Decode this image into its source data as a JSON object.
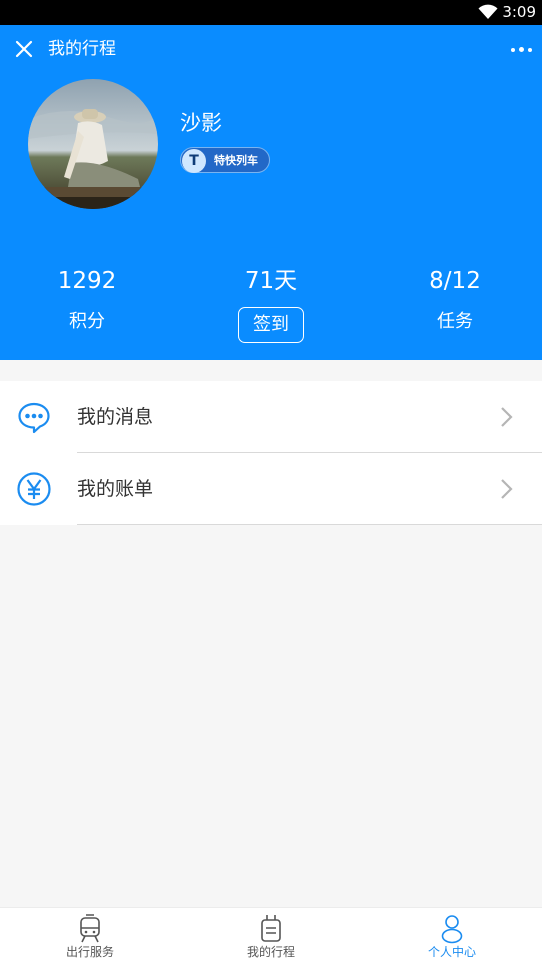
{
  "status_bar": {
    "time": "3:09"
  },
  "header": {
    "title": "我的行程"
  },
  "profile": {
    "username": "沙影",
    "badge": {
      "letter": "T",
      "text": "特快列车"
    }
  },
  "stats": [
    {
      "value": "1292",
      "label": "积分"
    },
    {
      "value": "71天",
      "button_label": "签到"
    },
    {
      "value": "8/12",
      "label": "任务"
    }
  ],
  "menu": [
    {
      "label": "我的消息",
      "icon": "message-icon"
    },
    {
      "label": "我的账单",
      "icon": "yen-icon"
    }
  ],
  "tabs": [
    {
      "label": "出行服务",
      "icon": "train-icon",
      "active": false
    },
    {
      "label": "我的行程",
      "icon": "luggage-icon",
      "active": false
    },
    {
      "label": "个人中心",
      "icon": "person-icon",
      "active": true
    }
  ],
  "colors": {
    "primary": "#0a8cff",
    "tab_active": "#1b8cf0",
    "badge_bg": "#2268c7"
  }
}
